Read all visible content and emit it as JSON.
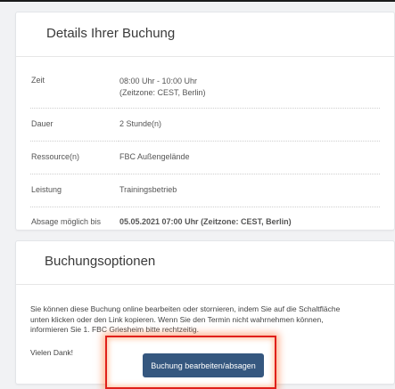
{
  "details": {
    "title": "Details Ihrer Buchung",
    "rows": [
      {
        "label": "Zeit",
        "value": "08:00 Uhr - 10:00 Uhr",
        "value2": "(Zeitzone: CEST, Berlin)"
      },
      {
        "label": "Dauer",
        "value": "2 Stunde(n)"
      },
      {
        "label": "Ressource(n)",
        "value": "FBC Außengelände"
      },
      {
        "label": "Leistung",
        "value": "Trainingsbetrieb"
      },
      {
        "label": "Absage möglich bis",
        "value": "05.05.2021 07:00 Uhr (Zeitzone: CEST, Berlin)"
      }
    ]
  },
  "options": {
    "title": "Buchungsoptionen",
    "text_line1": "Sie können diese Buchung online bearbeiten oder stornieren, indem Sie auf die Schaltfläche",
    "text_line2": "unten klicken oder den Link kopieren. Wenn Sie den Termin nicht wahrnehmen können,",
    "text_line3": "informieren Sie 1. FBC Griesheim bitte rechtzeitig.",
    "thanks": "Vielen Dank!",
    "button_label": "Buchung bearbeiten/absagen"
  },
  "colors": {
    "button_bg": "#35577f",
    "highlight": "#e0201b"
  }
}
